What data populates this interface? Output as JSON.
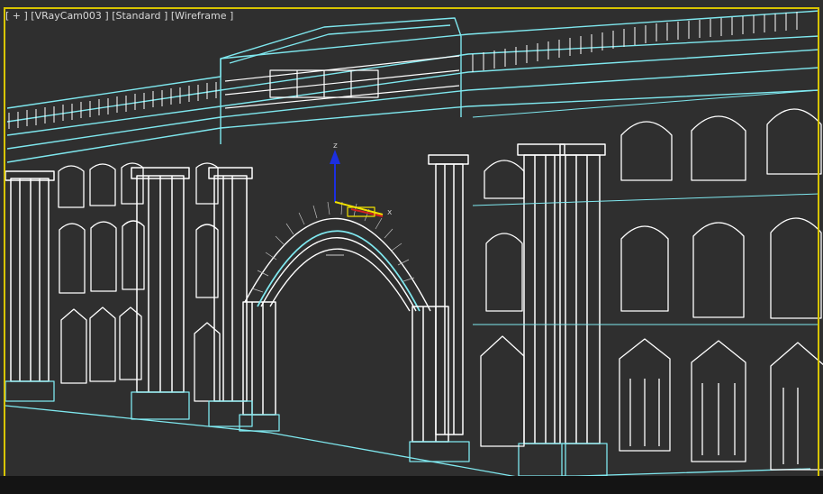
{
  "viewport": {
    "menu_label": "[ + ]",
    "camera_label": "[VRayCam003 ]",
    "shading_standard_label": "[Standard ]",
    "shading_wireframe_label": "[Wireframe ]"
  },
  "gizmo": {
    "z_axis_label": "z",
    "x_axis_label": "x"
  },
  "colors": {
    "background": "#2f2f2f",
    "frame_accent": "#d8c400",
    "wire_white": "#ffffff",
    "wire_cyan": "#7fe8ef",
    "gizmo_blue": "#1c2fe0",
    "gizmo_yellow": "#f2e200",
    "gizmo_red": "#d02020"
  }
}
